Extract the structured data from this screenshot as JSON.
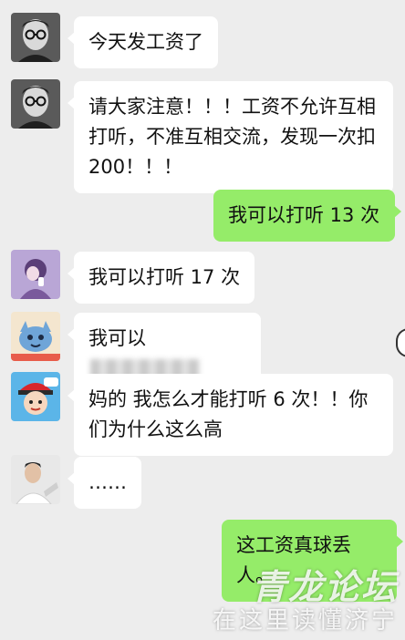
{
  "colors": {
    "background": "#ededed",
    "incoming_bubble": "#ffffff",
    "outgoing_bubble": "#95ec69"
  },
  "messages": [
    {
      "side": "left",
      "avatar": "portrait-man-glasses",
      "text": "今天发工资了"
    },
    {
      "side": "left",
      "avatar": "portrait-man-glasses",
      "text": "请大家注意！！！工资不允许互相打听，不准互相交流，发现一次扣200！！！"
    },
    {
      "side": "right",
      "text": "我可以打听 13 次"
    },
    {
      "side": "left",
      "avatar": "purple-cartoon-girl",
      "text": "我可以打听 17 次"
    },
    {
      "side": "left",
      "avatar": "blue-cartoon-creature",
      "text": "我可以"
    },
    {
      "side": "left",
      "avatar": "cartoon-boy-red-hat",
      "text": "妈的 我怎么才能打听 6 次！！你们为什么这么高"
    },
    {
      "side": "left",
      "avatar": "photo-young-man",
      "text": "……"
    },
    {
      "side": "right",
      "text": "这工资真球丢人。"
    }
  ],
  "watermark": {
    "line1": "青龙论坛",
    "line2": "在这里读懂济宁"
  }
}
